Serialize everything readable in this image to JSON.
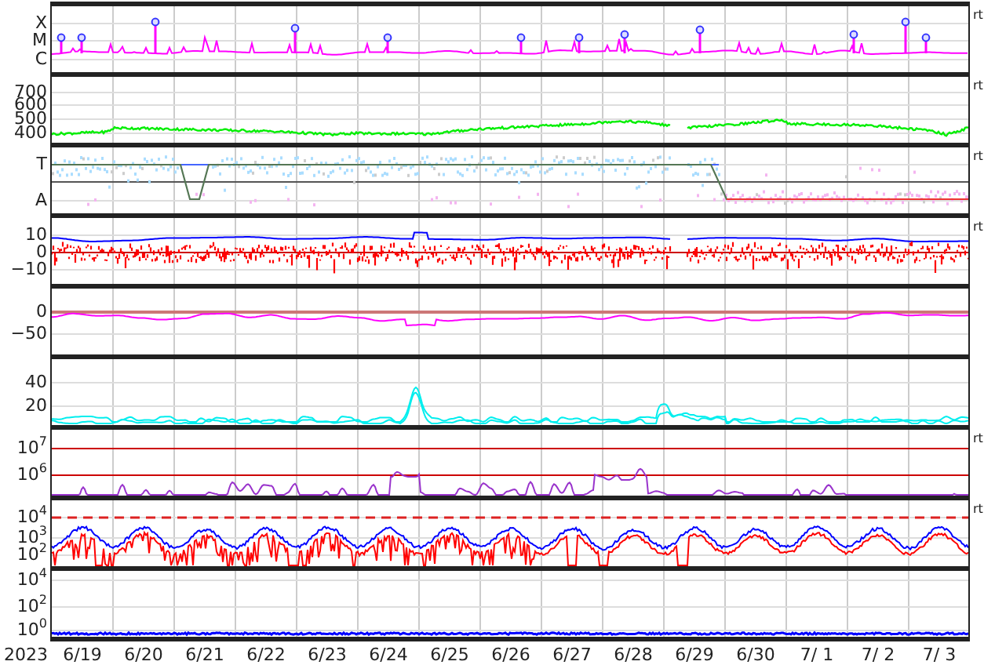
{
  "plot": {
    "panels": [
      {
        "kind": "xray",
        "ticks": [
          "X",
          "M",
          "C"
        ],
        "side_label": "rt"
      },
      {
        "kind": "speed",
        "ticks": [
          "700",
          "600",
          "500",
          "400"
        ],
        "side_label": "rt"
      },
      {
        "kind": "ta",
        "ticks": [
          "T",
          "A"
        ],
        "side_label": "rt"
      },
      {
        "kind": "bfield",
        "ticks": [
          "10",
          "0",
          "−10"
        ],
        "side_label": "rt"
      },
      {
        "kind": "dst",
        "ticks": [
          "0",
          "−50"
        ]
      },
      {
        "kind": "cyan",
        "ticks": [
          "40",
          "20"
        ]
      },
      {
        "kind": "electron",
        "ticks": [
          "10$^{7}$",
          "10$^{6}$"
        ],
        "side_label": "rt"
      },
      {
        "kind": "proton",
        "ticks": [
          "10$^{4}$",
          "10$^{3}$",
          "10$^{2}$"
        ],
        "side_label": "rt"
      },
      {
        "kind": "neutron",
        "ticks": [
          "10$^{4}$",
          "10$^{2}$",
          "10$^{0}$"
        ]
      }
    ],
    "x_axis": {
      "year": "2023",
      "dates": [
        "6/19",
        "6/20",
        "6/21",
        "6/22",
        "6/23",
        "6/24",
        "6/25",
        "6/26",
        "6/27",
        "6/28",
        "6/29",
        "6/30",
        "7/ 1",
        "7/ 2",
        "7/ 3"
      ]
    }
  }
}
